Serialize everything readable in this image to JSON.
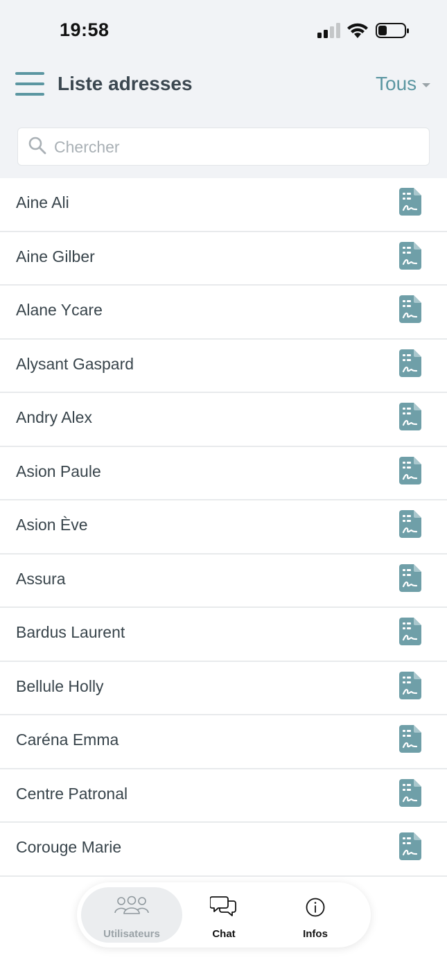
{
  "status_bar": {
    "time": "19:58"
  },
  "header": {
    "title": "Liste adresses",
    "filter_label": "Tous"
  },
  "search": {
    "placeholder": "Chercher",
    "value": ""
  },
  "contacts": [
    {
      "name": "Aine Ali"
    },
    {
      "name": "Aine Gilber"
    },
    {
      "name": "Alane Ycare"
    },
    {
      "name": "Alysant Gaspard"
    },
    {
      "name": "Andry Alex"
    },
    {
      "name": "Asion Paule"
    },
    {
      "name": "Asion Ève"
    },
    {
      "name": "Assura"
    },
    {
      "name": "Bardus Laurent"
    },
    {
      "name": "Bellule Holly"
    },
    {
      "name": "Caréna Emma"
    },
    {
      "name": "Centre Patronal"
    },
    {
      "name": "Corouge Marie"
    }
  ],
  "row_icon": "document-signature-icon",
  "tabbar": {
    "tabs": [
      {
        "label": "Utilisateurs",
        "icon": "users-icon",
        "active": true
      },
      {
        "label": "Chat",
        "icon": "chat-icon",
        "active": false
      },
      {
        "label": "Infos",
        "icon": "info-icon",
        "active": false
      }
    ]
  },
  "colors": {
    "accent": "#5b96a1",
    "header_bg": "#f1f3f6",
    "text": "#38444b",
    "divider": "#e8eaec"
  }
}
